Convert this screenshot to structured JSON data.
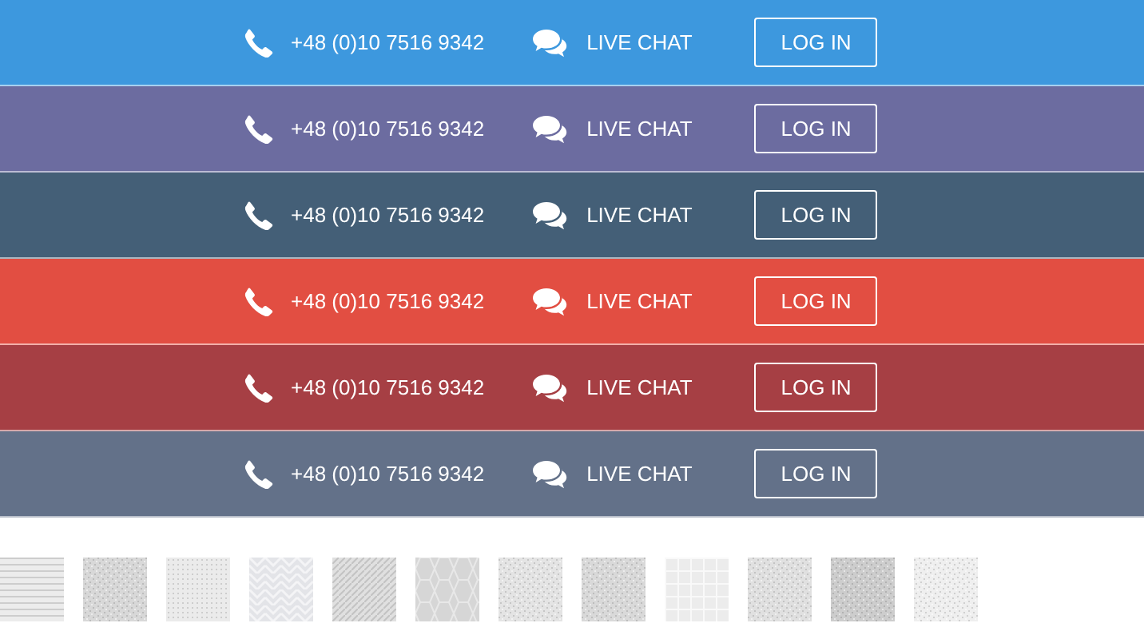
{
  "bars": [
    {
      "color": "#3d98de",
      "phone": "+48 (0)10 7516 9342",
      "chat": "LIVE CHAT",
      "login": "LOG IN"
    },
    {
      "color": "#6c6ca0",
      "phone": "+48 (0)10 7516 9342",
      "chat": "LIVE CHAT",
      "login": "LOG IN"
    },
    {
      "color": "#445f77",
      "phone": "+48 (0)10 7516 9342",
      "chat": "LIVE CHAT",
      "login": "LOG IN"
    },
    {
      "color": "#e24e42",
      "phone": "+48 (0)10 7516 9342",
      "chat": "LIVE CHAT",
      "login": "LOG IN"
    },
    {
      "color": "#a63f44",
      "phone": "+48 (0)10 7516 9342",
      "chat": "LIVE CHAT",
      "login": "LOG IN"
    },
    {
      "color": "#637189",
      "phone": "+48 (0)10 7516 9342",
      "chat": "LIVE CHAT",
      "login": "LOG IN"
    }
  ],
  "swatches": [
    {
      "kind": "stripes",
      "color": "#ececec"
    },
    {
      "kind": "speckle",
      "color": "#d8d8d8"
    },
    {
      "kind": "dots",
      "color": "#ebebeb"
    },
    {
      "kind": "chevron",
      "color": "#e3e4e8"
    },
    {
      "kind": "diagonal",
      "color": "#e0e0e0"
    },
    {
      "kind": "hexagon",
      "color": "#d6d6d6"
    },
    {
      "kind": "speckle",
      "color": "#e4e4e4"
    },
    {
      "kind": "speckle",
      "color": "#d9d9d9"
    },
    {
      "kind": "grid",
      "color": "#ececec"
    },
    {
      "kind": "speckle",
      "color": "#e0e0e0"
    },
    {
      "kind": "speckle",
      "color": "#cdcdcd"
    },
    {
      "kind": "speckle",
      "color": "#efefef"
    }
  ]
}
